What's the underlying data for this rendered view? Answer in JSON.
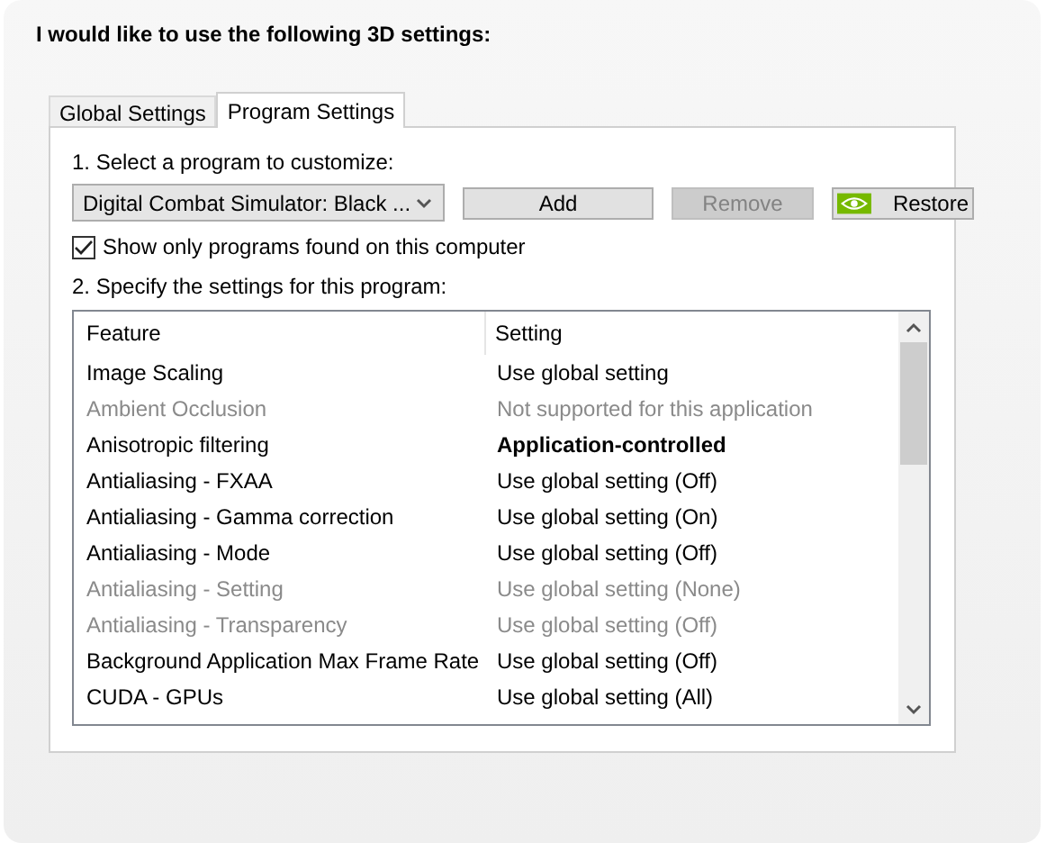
{
  "heading": "I would like to use the following 3D settings:",
  "tabs": [
    {
      "label": "Global Settings",
      "selected": false
    },
    {
      "label": "Program Settings",
      "selected": true
    }
  ],
  "select_label": "1. Select a program to customize:",
  "program_dropdown": {
    "value": "Digital Combat Simulator: Black ..."
  },
  "buttons": [
    {
      "label": "Add",
      "disabled": false,
      "kind": "plain"
    },
    {
      "label": "Remove",
      "disabled": true,
      "kind": "plain"
    },
    {
      "label": "Restore",
      "disabled": false,
      "kind": "logo"
    }
  ],
  "show_only_checkbox": {
    "label": "Show only programs found on this computer",
    "checked": true
  },
  "specify_label": "2. Specify the settings for this program:",
  "table": {
    "columns": [
      "Feature",
      "Setting"
    ],
    "rows": [
      {
        "feature": "Image Scaling",
        "setting": "Use global setting",
        "disabled": false,
        "setting_bold": false
      },
      {
        "feature": "Ambient Occlusion",
        "setting": "Not supported for this application",
        "disabled": true,
        "setting_bold": false
      },
      {
        "feature": "Anisotropic filtering",
        "setting": "Application-controlled",
        "disabled": false,
        "setting_bold": true
      },
      {
        "feature": "Antialiasing - FXAA",
        "setting": "Use global setting (Off)",
        "disabled": false,
        "setting_bold": false
      },
      {
        "feature": "Antialiasing - Gamma correction",
        "setting": "Use global setting (On)",
        "disabled": false,
        "setting_bold": false
      },
      {
        "feature": "Antialiasing - Mode",
        "setting": "Use global setting (Off)",
        "disabled": false,
        "setting_bold": false
      },
      {
        "feature": "Antialiasing - Setting",
        "setting": "Use global setting (None)",
        "disabled": true,
        "setting_bold": false
      },
      {
        "feature": "Antialiasing - Transparency",
        "setting": "Use global setting (Off)",
        "disabled": true,
        "setting_bold": false
      },
      {
        "feature": "Background Application Max Frame Rate",
        "setting": "Use global setting (Off)",
        "disabled": false,
        "setting_bold": false
      },
      {
        "feature": "CUDA - GPUs",
        "setting": "Use global setting (All)",
        "disabled": false,
        "setting_bold": false
      }
    ]
  }
}
